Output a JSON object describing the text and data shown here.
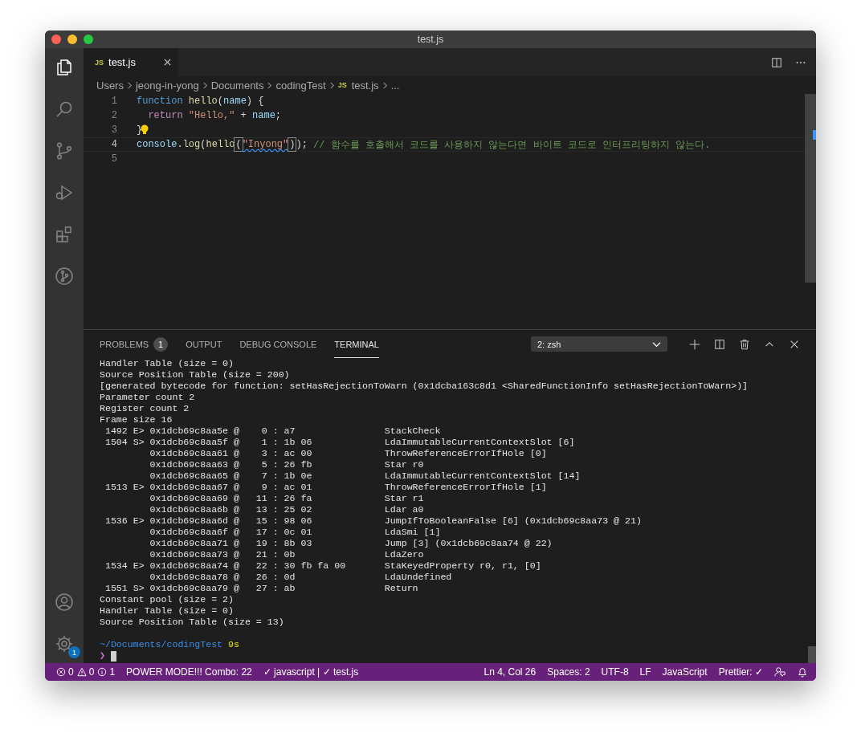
{
  "window": {
    "title": "test.js"
  },
  "activity_bar": {
    "settings_badge": "1"
  },
  "tabs": [
    {
      "icon_text": "JS",
      "label": "test.js",
      "selected": true
    }
  ],
  "breadcrumb": [
    {
      "label": "Users"
    },
    {
      "label": "jeong-in-yong"
    },
    {
      "label": "Documents"
    },
    {
      "label": "codingTest"
    },
    {
      "icon_text": "JS",
      "label": "test.js"
    },
    {
      "label": "..."
    }
  ],
  "editor": {
    "lines": [
      {
        "number": "1",
        "current": false,
        "tokens": [
          {
            "kind": "keyword",
            "text": "function"
          },
          {
            "kind": "function",
            "text": " hello"
          },
          {
            "kind": "plain",
            "text": "("
          },
          {
            "kind": "variable",
            "text": "name"
          },
          {
            "kind": "plain",
            "text": ") {"
          }
        ]
      },
      {
        "number": "2",
        "current": false,
        "tokens": [
          {
            "kind": "control",
            "text": "  return"
          },
          {
            "kind": "string",
            "text": " \"Hello,\""
          },
          {
            "kind": "plain",
            "text": " + "
          },
          {
            "kind": "variable",
            "text": "name"
          },
          {
            "kind": "plain",
            "text": ";"
          }
        ]
      },
      {
        "number": "3",
        "current": false,
        "lightbulb": true,
        "tokens": [
          {
            "kind": "plain",
            "text": "}"
          }
        ]
      },
      {
        "number": "4",
        "current": true,
        "tokens": [
          {
            "kind": "variable",
            "text": "console"
          },
          {
            "kind": "plain",
            "text": "."
          },
          {
            "kind": "function",
            "text": "log"
          },
          {
            "kind": "plain",
            "text": "("
          },
          {
            "kind": "function",
            "text": "hello"
          },
          {
            "kind": "bracket",
            "text": "("
          },
          {
            "kind": "squiggle",
            "text": "\"Inyong\""
          },
          {
            "kind": "bracket",
            "text": ")"
          },
          {
            "kind": "plain",
            "text": "); "
          },
          {
            "kind": "comment",
            "text": "// 함수를 호출해서 코드를 사용하지 않는다면 바이트 코드로 인터프리팅하지 않는다."
          }
        ]
      },
      {
        "number": "5",
        "current": false
      }
    ]
  },
  "panel": {
    "tabs": [
      {
        "label": "PROBLEMS",
        "badge": "1",
        "selected": false
      },
      {
        "label": "OUTPUT",
        "selected": false
      },
      {
        "label": "DEBUG CONSOLE",
        "selected": false
      },
      {
        "label": "TERMINAL",
        "selected": true
      }
    ],
    "terminal_select": "2: zsh",
    "terminal_lines": [
      "Handler Table (size = 0)",
      "Source Position Table (size = 200)",
      "[generated bytecode for function: setHasRejectionToWarn (0x1dcba163c8d1 <SharedFunctionInfo setHasRejectionToWarn>)]",
      "Parameter count 2",
      "Register count 2",
      "Frame size 16",
      " 1492 E> 0x1dcb69c8aa5e @    0 : a7                StackCheck",
      " 1504 S> 0x1dcb69c8aa5f @    1 : 1b 06             LdaImmutableCurrentContextSlot [6]",
      "         0x1dcb69c8aa61 @    3 : ac 00             ThrowReferenceErrorIfHole [0]",
      "         0x1dcb69c8aa63 @    5 : 26 fb             Star r0",
      "         0x1dcb69c8aa65 @    7 : 1b 0e             LdaImmutableCurrentContextSlot [14]",
      " 1513 E> 0x1dcb69c8aa67 @    9 : ac 01             ThrowReferenceErrorIfHole [1]",
      "         0x1dcb69c8aa69 @   11 : 26 fa             Star r1",
      "         0x1dcb69c8aa6b @   13 : 25 02             Ldar a0",
      " 1536 E> 0x1dcb69c8aa6d @   15 : 98 06             JumpIfToBooleanFalse [6] (0x1dcb69c8aa73 @ 21)",
      "         0x1dcb69c8aa6f @   17 : 0c 01             LdaSmi [1]",
      "         0x1dcb69c8aa71 @   19 : 8b 03             Jump [3] (0x1dcb69c8aa74 @ 22)",
      "         0x1dcb69c8aa73 @   21 : 0b                LdaZero",
      " 1534 E> 0x1dcb69c8aa74 @   22 : 30 fb fa 00       StaKeyedProperty r0, r1, [0]",
      "         0x1dcb69c8aa78 @   26 : 0d                LdaUndefined",
      " 1551 S> 0x1dcb69c8aa79 @   27 : ab                Return",
      "Constant pool (size = 2)",
      "Handler Table (size = 0)",
      "Source Position Table (size = 13)"
    ],
    "prompt": {
      "path": "~/Documents/codingTest",
      "duration": "9s",
      "symbol": "❯"
    }
  },
  "status_bar": {
    "left": [
      {
        "kind": "errors",
        "text": "0"
      },
      {
        "kind": "warnings",
        "text": "0"
      },
      {
        "kind": "info",
        "text": "1"
      },
      {
        "kind": "text",
        "text": "POWER MODE!!! Combo: 22"
      },
      {
        "kind": "text",
        "text": "✓ javascript | ✓ test.js"
      }
    ],
    "right": [
      {
        "kind": "text",
        "text": "Ln 4, Col 26"
      },
      {
        "kind": "text",
        "text": "Spaces: 2"
      },
      {
        "kind": "text",
        "text": "UTF-8"
      },
      {
        "kind": "text",
        "text": "LF"
      },
      {
        "kind": "text",
        "text": "JavaScript"
      },
      {
        "kind": "text",
        "text": "Prettier: ✓"
      },
      {
        "kind": "feedback"
      },
      {
        "kind": "bell"
      }
    ]
  }
}
